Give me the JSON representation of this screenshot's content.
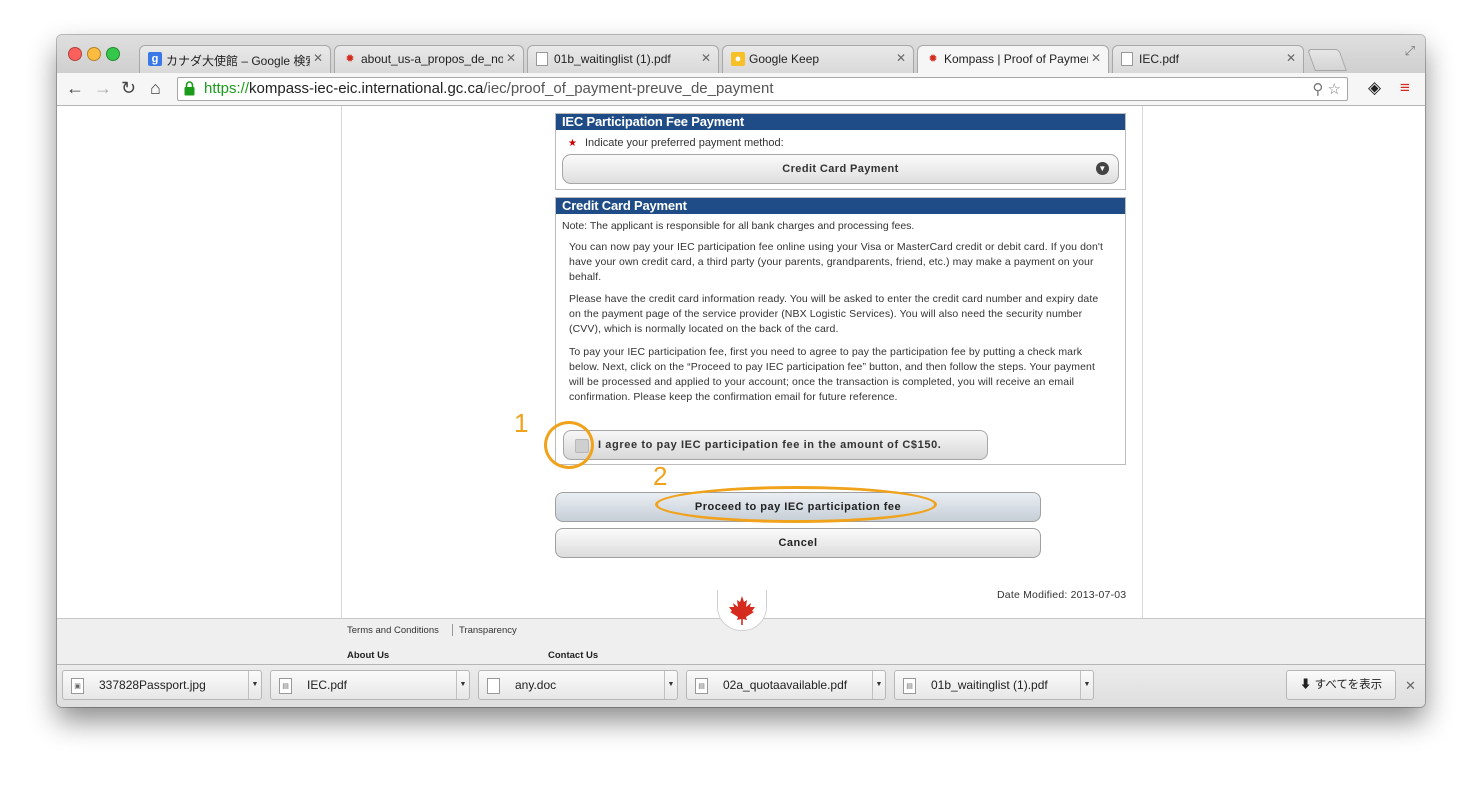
{
  "browser": {
    "tabs": [
      {
        "label": "カナダ大使館 – Google 検索",
        "favicon": "google-g-icon"
      },
      {
        "label": "about_us-a_propos_de_nous",
        "favicon": "maple-leaf-icon"
      },
      {
        "label": "01b_waitinglist (1).pdf",
        "favicon": "document-icon"
      },
      {
        "label": "Google Keep",
        "favicon": "keep-bulb-icon"
      },
      {
        "label": "Kompass | Proof of Payment",
        "favicon": "maple-leaf-icon"
      },
      {
        "label": "IEC.pdf",
        "favicon": "document-icon"
      }
    ],
    "url": {
      "scheme": "https://",
      "host": "kompass-iec-eic.international.gc.ca",
      "path": "/iec/proof_of_payment-preuve_de_payment"
    }
  },
  "fee_panel": {
    "title": "IEC Participation Fee Payment",
    "prompt": "Indicate your preferred payment method:",
    "selected_method": "Credit Card Payment"
  },
  "cc_panel": {
    "title": "Credit Card Payment",
    "note": "Note: The applicant is responsible for all bank charges and processing fees.",
    "paragraphs": [
      "You can now pay your IEC participation fee online using your Visa or MasterCard credit or debit card. If you don't have your own credit card, a third party (your parents, grandparents, friend, etc.) may make a payment on your behalf.",
      "Please have the credit card information ready. You will be asked to enter the credit card number and expiry date on the payment page of the service provider (NBX Logistic Services). You will also need the security number (CVV), which is normally located on the back of the card.",
      "To pay your IEC participation fee, first you need to agree to pay the participation fee by putting a check mark below. Next, click on the “Proceed to pay IEC participation fee” button, and then follow the steps. Your payment will be processed and applied to your account; once the transaction is completed, you will receive an email confirmation. Please keep the confirmation email for future reference."
    ],
    "agree_label": "I agree to pay IEC participation fee in the amount of C$150."
  },
  "buttons": {
    "proceed": "Proceed to pay IEC participation fee",
    "cancel": "Cancel"
  },
  "annotations": {
    "step1": "1",
    "step2": "2",
    "color": "#f0a21b"
  },
  "date_modified": "Date Modified: 2013-07-03",
  "footer": {
    "terms": "Terms and Conditions",
    "transparency": "Transparency",
    "about": "About Us",
    "contact": "Contact Us"
  },
  "downloads": {
    "items": [
      "337828Passport.jpg",
      "IEC.pdf",
      "any.doc",
      "02a_quotaavailable.pdf",
      "01b_waitinglist (1).pdf"
    ],
    "show_all": "すべてを表示"
  },
  "colors": {
    "panel_header": "#1f4c87",
    "secure_green": "#1a9c1a",
    "maple_red": "#d52b1e"
  }
}
